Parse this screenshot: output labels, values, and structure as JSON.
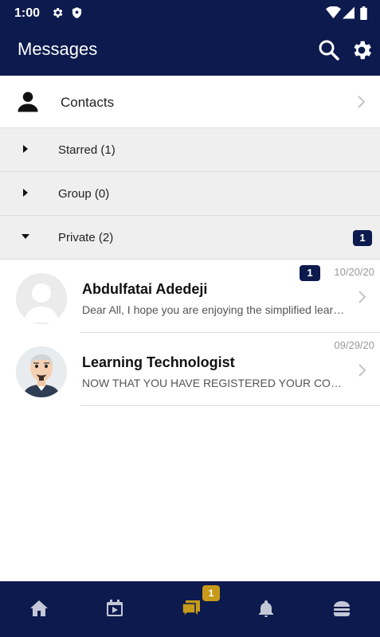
{
  "status_bar": {
    "time": "1:00"
  },
  "app_bar": {
    "title": "Messages"
  },
  "contacts": {
    "label": "Contacts"
  },
  "groups": [
    {
      "label": "Starred (1)",
      "expanded": false,
      "unread": ""
    },
    {
      "label": "Group (0)",
      "expanded": false,
      "unread": ""
    },
    {
      "label": "Private (2)",
      "expanded": true,
      "unread": "1"
    }
  ],
  "conversations": [
    {
      "name": "Abdulfatai Adedeji",
      "preview": "Dear All, I hope you are enjoying the simplified learning experience",
      "date": "10/20/20",
      "unread": "1",
      "avatar": "default-avatar"
    },
    {
      "name": "Learning Technologist",
      "preview": "NOW THAT YOU HAVE REGISTERED YOUR COURSES",
      "date": "09/29/20",
      "unread": "",
      "avatar": "cartoon-avatar"
    }
  ],
  "bottom_nav": {
    "items": [
      {
        "icon": "home-icon"
      },
      {
        "icon": "calendar-icon"
      },
      {
        "icon": "chat-icon",
        "badge": "1",
        "active": true
      },
      {
        "icon": "bell-icon"
      },
      {
        "icon": "menu-icon"
      }
    ]
  },
  "colors": {
    "primary": "#0c1a4d",
    "accent": "#c79a1a",
    "group_bg": "#efefef"
  }
}
